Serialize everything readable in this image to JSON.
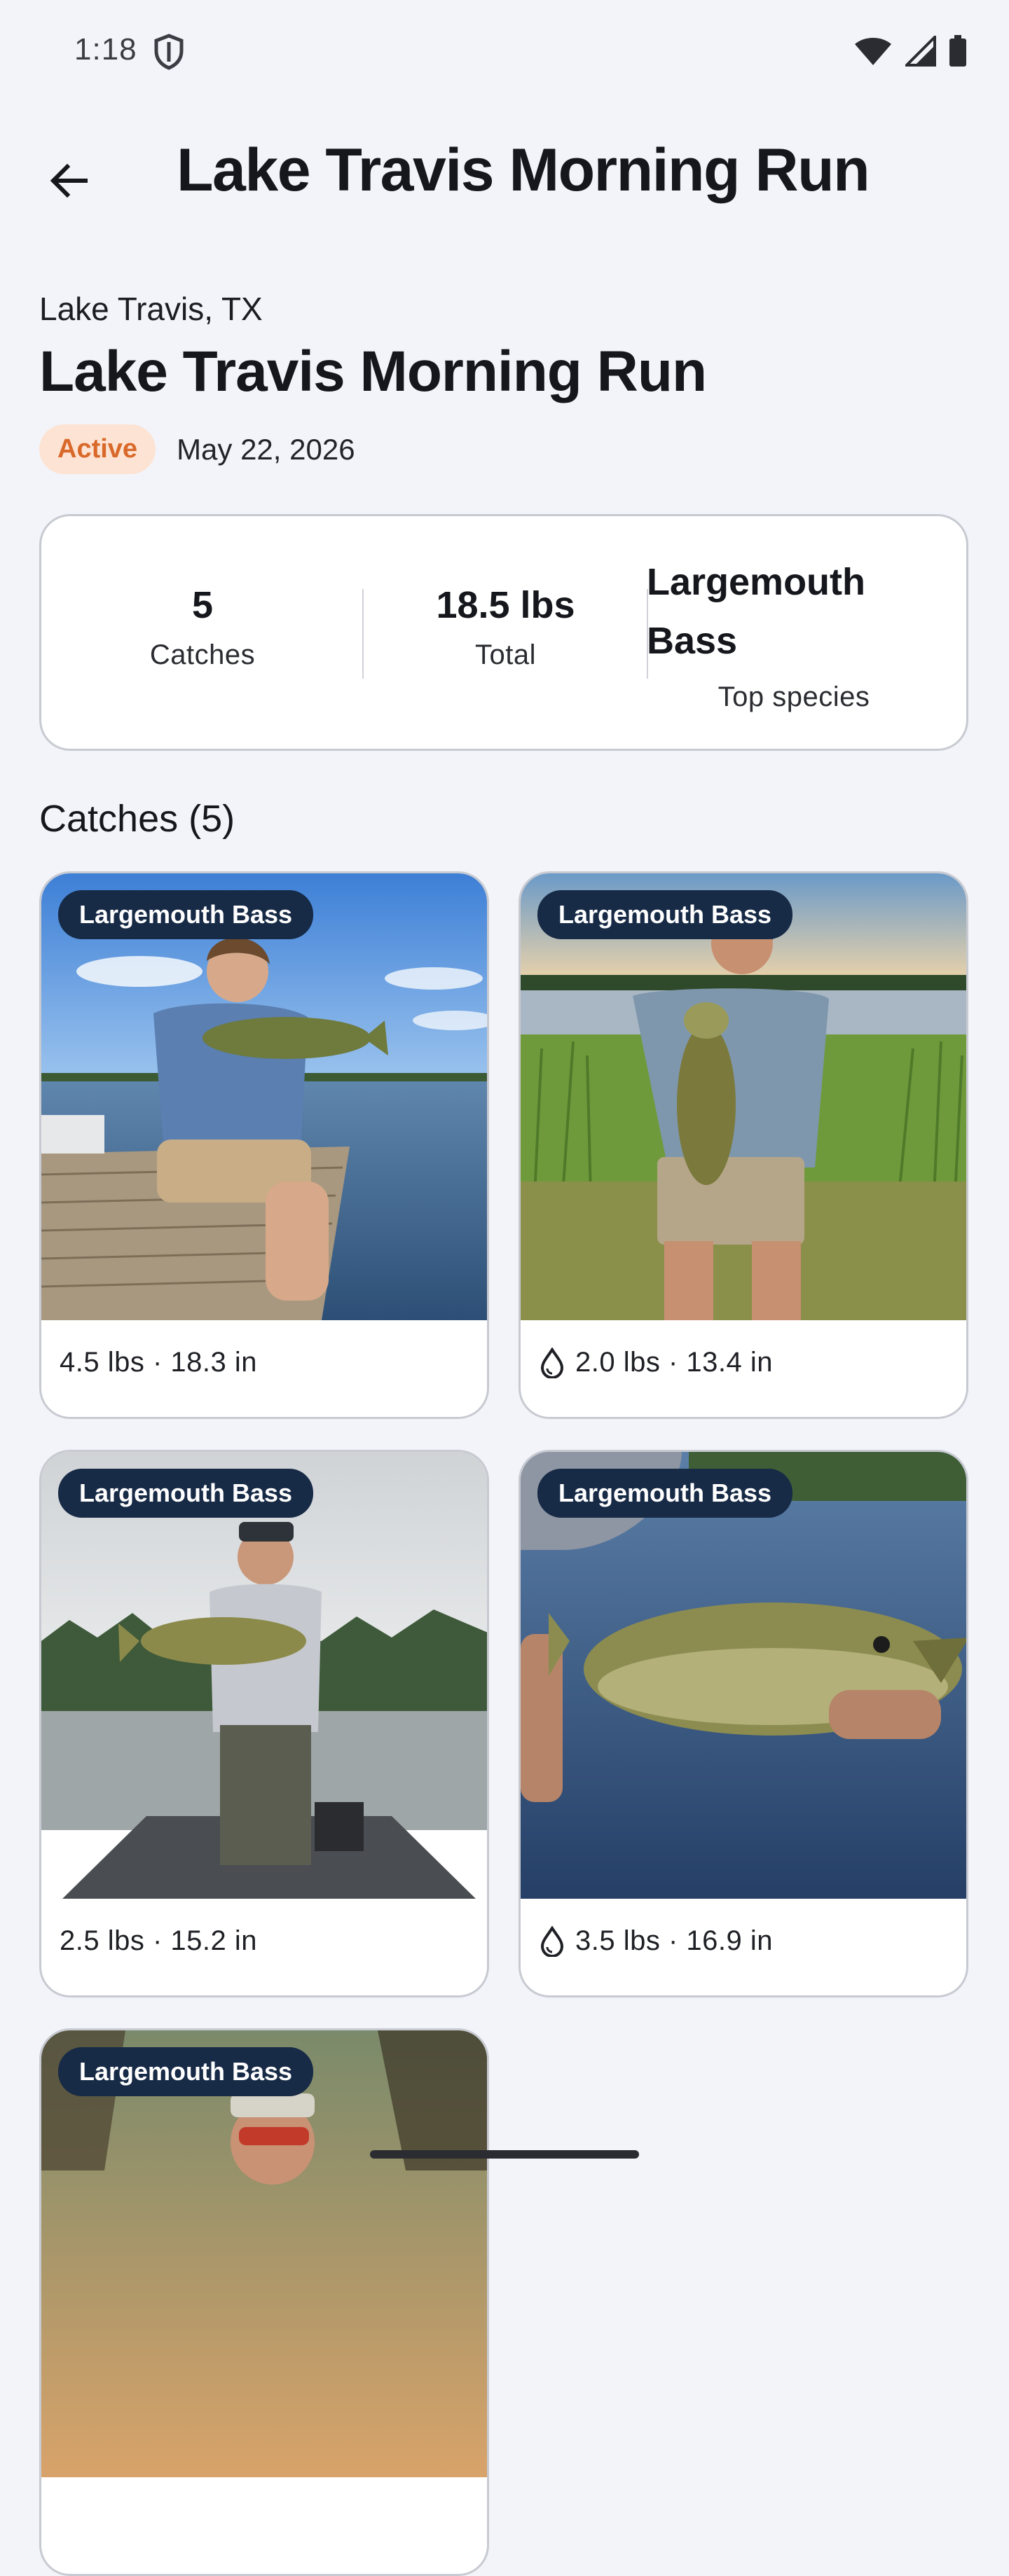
{
  "status_bar": {
    "time": "1:18",
    "icons": [
      "shield-icon",
      "wifi-icon",
      "signal-icon",
      "battery-icon"
    ]
  },
  "app_bar": {
    "title": "Lake Travis Morning Run",
    "back_icon": "arrow-left-icon"
  },
  "trip": {
    "location": "Lake Travis, TX",
    "title": "Lake Travis Morning Run",
    "status": "Active",
    "date": "May 22, 2026"
  },
  "stats": [
    {
      "value": "5",
      "label": "Catches"
    },
    {
      "value": "18.5 lbs",
      "label": "Total"
    },
    {
      "value": "Largemouth Bass",
      "label": "Top species"
    }
  ],
  "catches_header": "Catches (5)",
  "catches": [
    {
      "species": "Largemouth Bass",
      "summary": "4.5 lbs · 18.3 in",
      "has_drop_icon": false
    },
    {
      "species": "Largemouth Bass",
      "summary": "2.0 lbs · 13.4 in",
      "has_drop_icon": true
    },
    {
      "species": "Largemouth Bass",
      "summary": "2.5 lbs · 15.2 in",
      "has_drop_icon": false
    },
    {
      "species": "Largemouth Bass",
      "summary": "3.5 lbs · 16.9 in",
      "has_drop_icon": true
    },
    {
      "species": "Largemouth Bass",
      "summary": "",
      "has_drop_icon": false
    }
  ],
  "colors": {
    "accent_active_bg": "#fde3d3",
    "accent_active_text": "#d9692a",
    "tag_bg": "#172a46",
    "page_bg": "#f3f4f9"
  }
}
